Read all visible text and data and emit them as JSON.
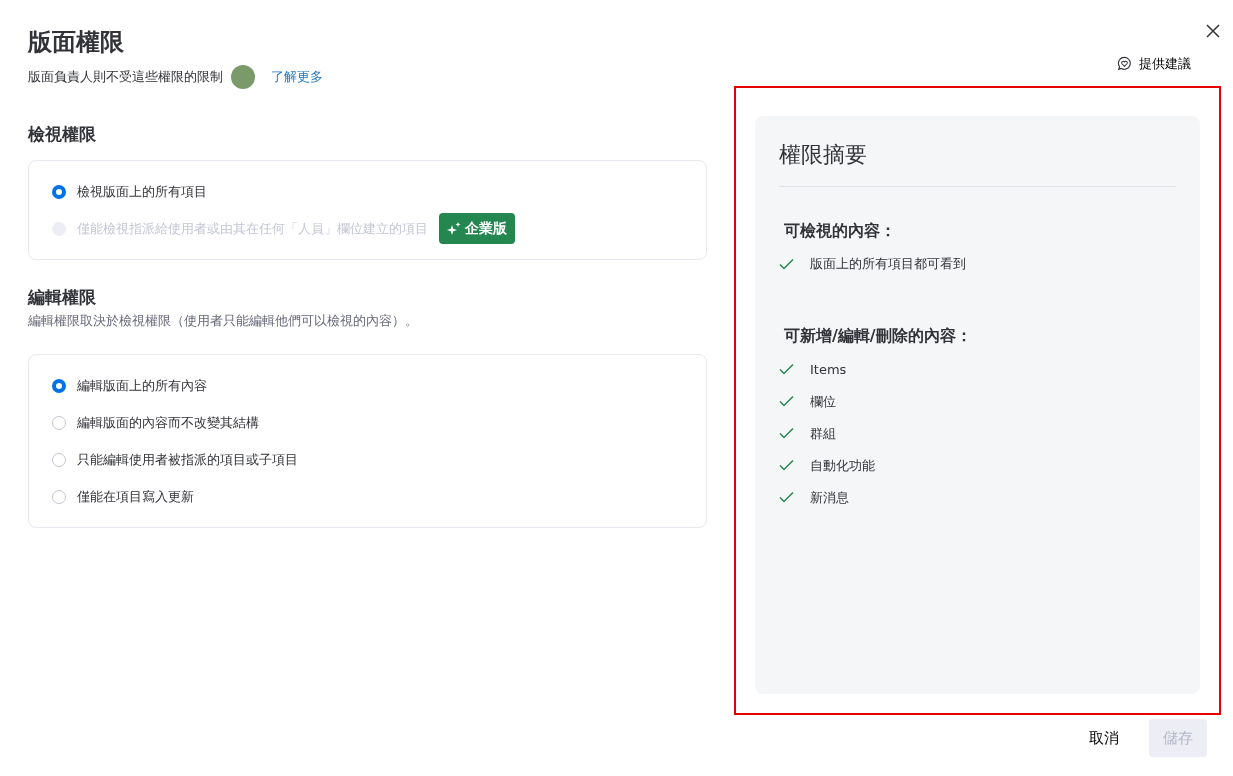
{
  "title": "版面權限",
  "subtitle": "版面負責人則不受這些權限的限制",
  "learn_more": "了解更多",
  "feedback": "提供建議",
  "view_section": {
    "title": "檢視權限",
    "options": [
      {
        "label": "檢視版面上的所有項目",
        "selected": true,
        "disabled": false
      },
      {
        "label": "僅能檢視指派給使用者或由其在任何「人員」欄位建立的項目",
        "selected": false,
        "disabled": true,
        "badge": "企業版"
      }
    ]
  },
  "edit_section": {
    "title": "編輯權限",
    "description": "編輯權限取決於檢視權限（使用者只能編輯他們可以檢視的內容）。",
    "options": [
      {
        "label": "編輯版面上的所有內容",
        "selected": true,
        "disabled": false
      },
      {
        "label": "編輯版面的內容而不改變其結構",
        "selected": false,
        "disabled": false
      },
      {
        "label": "只能編輯使用者被指派的項目或子項目",
        "selected": false,
        "disabled": false
      },
      {
        "label": "僅能在項目寫入更新",
        "selected": false,
        "disabled": false
      }
    ]
  },
  "summary": {
    "highlighted": true,
    "title": "權限摘要",
    "groups": [
      {
        "heading": "可檢視的內容：",
        "items": [
          "版面上的所有項目都可看到"
        ]
      },
      {
        "heading": "可新增/編輯/刪除的內容：",
        "items": [
          "Items",
          "欄位",
          "群組",
          "自動化功能",
          "新消息"
        ]
      }
    ]
  },
  "buttons": [
    {
      "label": "取消",
      "disabled": false
    },
    {
      "label": "儲存",
      "disabled": true
    }
  ]
}
